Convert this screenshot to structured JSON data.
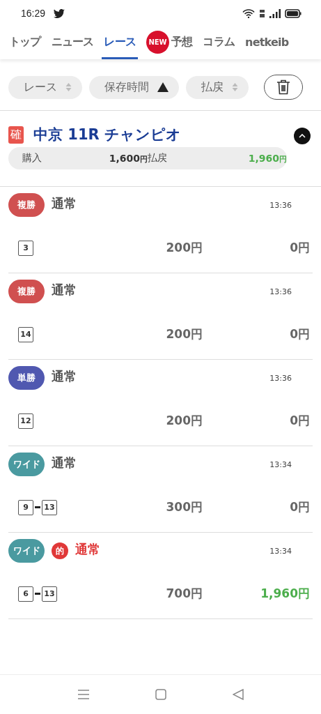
{
  "status_bar": {
    "time": "16:29"
  },
  "tabs": [
    {
      "label": "トップ",
      "selected": false
    },
    {
      "label": "ニュース",
      "selected": false
    },
    {
      "label": "レース",
      "selected": true
    },
    {
      "label": "予想",
      "selected": false,
      "badge": "NEW"
    },
    {
      "label": "コラム",
      "selected": false
    },
    {
      "label": "netkeib",
      "selected": false
    }
  ],
  "sort_chips": [
    {
      "label": "レース",
      "kind": "unsorted"
    },
    {
      "label": "保存時間",
      "kind": "ascending"
    },
    {
      "label": "払戻",
      "kind": "unsorted"
    }
  ],
  "race": {
    "badge": "確",
    "title": "中京 11R チャンピオ",
    "expanded": true,
    "purchase_label": "購入",
    "purchase": "1,600",
    "purchase_unit": "円",
    "payout_label": "払戻",
    "payout": "1,960",
    "payout_unit": "円"
  },
  "bets": [
    {
      "type": "複勝",
      "color": "#d05050",
      "hit": false,
      "name": "通常",
      "time": "13:36",
      "numbers": [
        "3"
      ],
      "amount": "200円",
      "payout": "0円"
    },
    {
      "type": "複勝",
      "color": "#d05050",
      "hit": false,
      "name": "通常",
      "time": "13:36",
      "numbers": [
        "14"
      ],
      "amount": "200円",
      "payout": "0円"
    },
    {
      "type": "単勝",
      "color": "#5058b0",
      "hit": false,
      "name": "通常",
      "time": "13:36",
      "numbers": [
        "12"
      ],
      "amount": "200円",
      "payout": "0円"
    },
    {
      "type": "ワイド",
      "color": "#4a9aa0",
      "hit": false,
      "name": "通常",
      "time": "13:34",
      "numbers": [
        "9",
        "13"
      ],
      "amount": "300円",
      "payout": "0円"
    },
    {
      "type": "ワイド",
      "color": "#4a9aa0",
      "hit": true,
      "hit_label": "的",
      "name": "通常",
      "time": "13:34",
      "numbers": [
        "6",
        "13"
      ],
      "amount": "700円",
      "payout": "1,960円"
    }
  ]
}
